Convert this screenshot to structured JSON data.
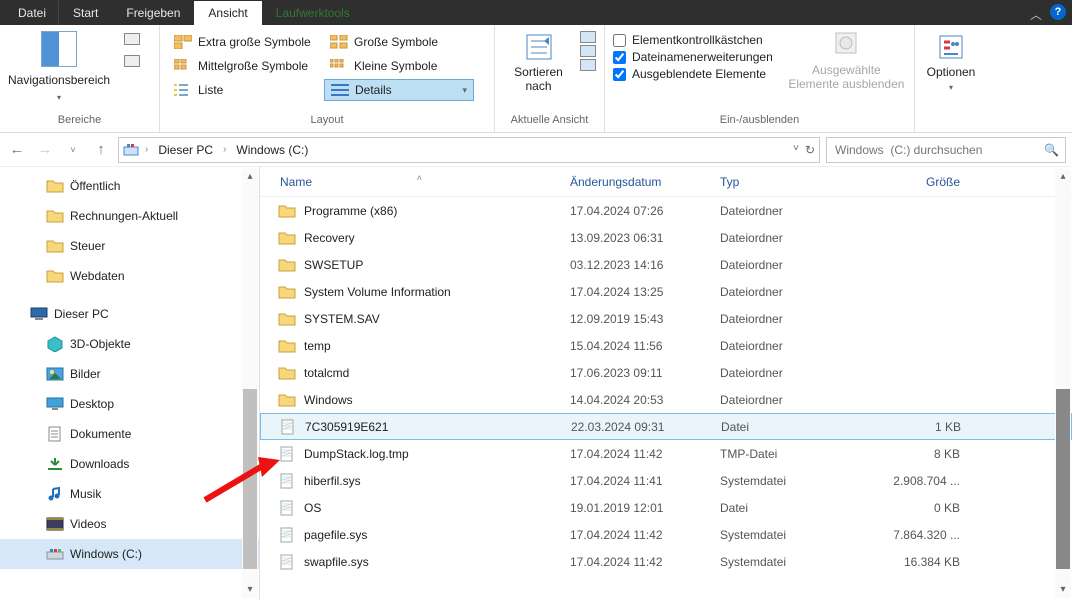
{
  "titlebar": {
    "file": "Datei",
    "tabs": [
      {
        "label": "Start"
      },
      {
        "label": "Freigeben"
      },
      {
        "label": "Ansicht",
        "active": true
      },
      {
        "label": "Laufwerktools",
        "context": true
      }
    ]
  },
  "ribbon": {
    "panes": {
      "label": "Bereiche",
      "nav": "Navigationsbereich"
    },
    "layout": {
      "label": "Layout",
      "items": [
        {
          "label": "Extra große Symbole"
        },
        {
          "label": "Große Symbole"
        },
        {
          "label": "Mittelgroße Symbole"
        },
        {
          "label": "Kleine Symbole"
        },
        {
          "label": "Liste"
        },
        {
          "label": "Details",
          "selected": true
        }
      ]
    },
    "currentview": {
      "label": "Aktuelle Ansicht",
      "sort": "Sortieren nach"
    },
    "visibility": {
      "label": "Ein-/ausblenden",
      "chk1": "Elementkontrollkästchen",
      "chk2": "Dateinamenerweiterungen",
      "chk3": "Ausgeblendete Elemente",
      "hide": "Ausgewählte Elemente ausblenden"
    },
    "options": {
      "label": "Optionen"
    }
  },
  "nav": {
    "breadcrumb": [
      "Dieser PC",
      "Windows  (C:)"
    ],
    "search_placeholder": "Windows  (C:) durchsuchen"
  },
  "tree": [
    {
      "label": "Öffentlich",
      "icon": "folder",
      "sub": true
    },
    {
      "label": "Rechnungen-Aktuell",
      "icon": "folder",
      "sub": true
    },
    {
      "label": "Steuer",
      "icon": "folder",
      "sub": true
    },
    {
      "label": "Webdaten",
      "icon": "folder",
      "sub": true
    },
    {
      "label": "",
      "icon": "",
      "sub": false,
      "spacer": true
    },
    {
      "label": "Dieser PC",
      "icon": "thispc",
      "sub": false
    },
    {
      "label": "3D-Objekte",
      "icon": "3d",
      "sub": true
    },
    {
      "label": "Bilder",
      "icon": "pictures",
      "sub": true
    },
    {
      "label": "Desktop",
      "icon": "desktop",
      "sub": true
    },
    {
      "label": "Dokumente",
      "icon": "docs",
      "sub": true
    },
    {
      "label": "Downloads",
      "icon": "downloads",
      "sub": true
    },
    {
      "label": "Musik",
      "icon": "music",
      "sub": true
    },
    {
      "label": "Videos",
      "icon": "videos",
      "sub": true
    },
    {
      "label": "Windows  (C:)",
      "icon": "drive",
      "sub": true,
      "sel": true
    }
  ],
  "columns": {
    "name": "Name",
    "mod": "Änderungsdatum",
    "type": "Typ",
    "size": "Größe"
  },
  "files": [
    {
      "name": "Programme (x86)",
      "mod": "17.04.2024 07:26",
      "type": "Dateiordner",
      "size": "",
      "icon": "folder"
    },
    {
      "name": "Recovery",
      "mod": "13.09.2023 06:31",
      "type": "Dateiordner",
      "size": "",
      "icon": "folder"
    },
    {
      "name": "SWSETUP",
      "mod": "03.12.2023 14:16",
      "type": "Dateiordner",
      "size": "",
      "icon": "folder"
    },
    {
      "name": "System Volume Information",
      "mod": "17.04.2024 13:25",
      "type": "Dateiordner",
      "size": "",
      "icon": "folder"
    },
    {
      "name": "SYSTEM.SAV",
      "mod": "12.09.2019 15:43",
      "type": "Dateiordner",
      "size": "",
      "icon": "folder"
    },
    {
      "name": "temp",
      "mod": "15.04.2024 11:56",
      "type": "Dateiordner",
      "size": "",
      "icon": "folder"
    },
    {
      "name": "totalcmd",
      "mod": "17.06.2023 09:11",
      "type": "Dateiordner",
      "size": "",
      "icon": "folder"
    },
    {
      "name": "Windows",
      "mod": "14.04.2024 20:53",
      "type": "Dateiordner",
      "size": "",
      "icon": "folder"
    },
    {
      "name": "7C305919E621",
      "mod": "22.03.2024 09:31",
      "type": "Datei",
      "size": "1 KB",
      "icon": "file",
      "sel": true
    },
    {
      "name": "DumpStack.log.tmp",
      "mod": "17.04.2024 11:42",
      "type": "TMP-Datei",
      "size": "8 KB",
      "icon": "file"
    },
    {
      "name": "hiberfil.sys",
      "mod": "17.04.2024 11:41",
      "type": "Systemdatei",
      "size": "2.908.704 ...",
      "icon": "file"
    },
    {
      "name": "OS",
      "mod": "19.01.2019 12:01",
      "type": "Datei",
      "size": "0 KB",
      "icon": "file"
    },
    {
      "name": "pagefile.sys",
      "mod": "17.04.2024 11:42",
      "type": "Systemdatei",
      "size": "7.864.320 ...",
      "icon": "file"
    },
    {
      "name": "swapfile.sys",
      "mod": "17.04.2024 11:42",
      "type": "Systemdatei",
      "size": "16.384 KB",
      "icon": "file"
    }
  ]
}
